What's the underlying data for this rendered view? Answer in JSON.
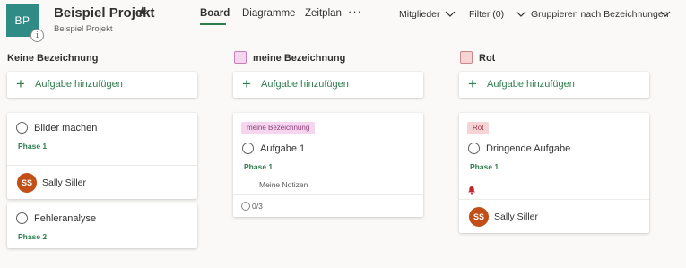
{
  "project": {
    "initials": "BP",
    "title": "Beispiel Projekt",
    "subtitle": "Beispiel Projekt",
    "info_glyph": "i",
    "star_glyph": "★",
    "tile_color": "#2e8b86"
  },
  "nav": {
    "tabs": [
      {
        "label": "Board",
        "active": true
      },
      {
        "label": "Diagramme",
        "active": false
      },
      {
        "label": "Zeitplan",
        "active": false
      }
    ],
    "more": "···"
  },
  "filters": {
    "members": "Mitglieder",
    "filter": "Filter (0)",
    "group": "Gruppieren nach Bezeichnungen"
  },
  "colors": {
    "accent": "#2f7e4f",
    "avatar": "#c24f18",
    "pink_swatch": "#f6d6ee",
    "pink_border": "#c77fb8",
    "red_swatch": "#f6d4d6",
    "red_border": "#c9878b"
  },
  "add_task_label": "Aufgabe hinzufügen",
  "columns": [
    {
      "name": "Keine Bezeichnung",
      "tasks": [
        {
          "title": "Bilder machen",
          "phase": "Phase 1",
          "assignee": {
            "initials": "SS",
            "name": "Sally Siller"
          }
        },
        {
          "title": "Fehleranalyse",
          "phase": "Phase 2"
        }
      ]
    },
    {
      "name": "meine Bezeichnung",
      "tasks": [
        {
          "label": "meine Bezeichnung",
          "title": "Aufgabe 1",
          "phase": "Phase 1",
          "notes": "Meine Notizen",
          "checklist": "0/3"
        }
      ]
    },
    {
      "name": "Rot",
      "tasks": [
        {
          "label": "Rot",
          "title": "Dringende Aufgabe",
          "phase": "Phase 1",
          "priority_icon": "urgent-bell-icon",
          "assignee": {
            "initials": "SS",
            "name": "Sally Siller"
          }
        }
      ]
    }
  ]
}
